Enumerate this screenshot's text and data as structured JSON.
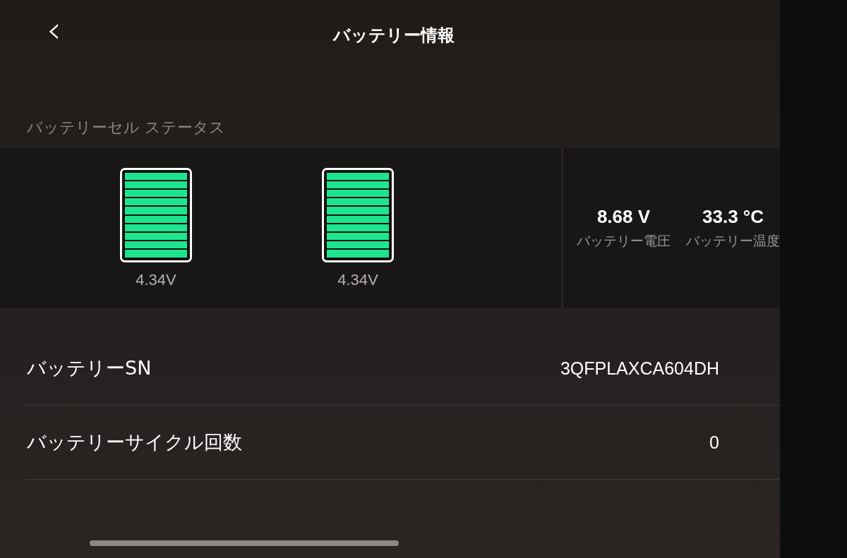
{
  "header": {
    "back": "‹",
    "title": "バッテリー情報"
  },
  "cell_status": {
    "label": "バッテリーセル ステータス",
    "cells": [
      {
        "reading": "4.34V"
      },
      {
        "reading": "4.34V"
      }
    ],
    "stats": [
      {
        "value": "8.68 V",
        "label": "バッテリー電圧"
      },
      {
        "value": "33.3 °C",
        "label": "バッテリー温度"
      }
    ]
  },
  "rows": [
    {
      "label": "バッテリーSN",
      "value": "3QFPLAXCA604DH"
    },
    {
      "label": "バッテリーサイクル回数",
      "value": "0"
    }
  ]
}
